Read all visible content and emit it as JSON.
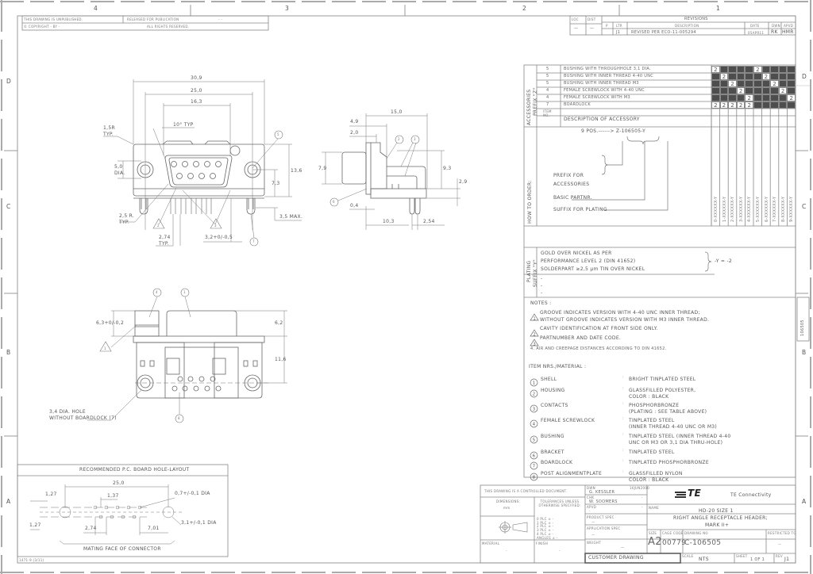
{
  "frame": {
    "col_markers": [
      "4",
      "3",
      "2",
      "1"
    ],
    "row_markers": [
      "D",
      "C",
      "B",
      "A"
    ]
  },
  "top_left_box": {
    "unpublished": "THIS DRAWING IS UNPUBLISHED.",
    "copyright": "COPYRIGHT  -   BY -",
    "released": "RELEASED FOR PUBLICATION",
    "released_value": "- -",
    "rights": "ALL RIGHTS RESERVED."
  },
  "revisions": {
    "title": "REVISIONS",
    "loc_label": "LOC",
    "dist_label": "DIST",
    "loc_value": "—",
    "dist_value": "—",
    "headers": [
      "P",
      "LTR",
      "DESCRIPTION",
      "DATE",
      "DWN",
      "APVD"
    ],
    "rows": [
      {
        "p": "",
        "ltr": "J1",
        "description": "REVISED PER ECO-11-005294",
        "date": "05APR11",
        "dwn": "RK",
        "apvd": "HMR"
      }
    ]
  },
  "accessories": {
    "side_label": "ACCESSORIES",
    "prefix_label": "PREFIX \"Z\"",
    "rows": [
      {
        "item": "5",
        "description": "BUSHING WITH THROUGHHOLE 3,1 DIA.",
        "marks": [
          "2",
          "",
          "",
          "",
          "",
          "2",
          "",
          "",
          "",
          ""
        ]
      },
      {
        "item": "5",
        "description": "BUSHING WITH INNER THREAD 4-40 UNC",
        "marks": [
          "",
          "2",
          "",
          "",
          "",
          "",
          "2",
          "",
          "",
          ""
        ]
      },
      {
        "item": "5",
        "description": "BUSHING WITH INNER THREAD M3",
        "marks": [
          "",
          "",
          "2",
          "",
          "",
          "",
          "",
          "2",
          "",
          ""
        ]
      },
      {
        "item": "4",
        "description": "FEMALE SCREWLOCK WITH 4-40 UNC",
        "marks": [
          "",
          "",
          "",
          "2",
          "",
          "",
          "",
          "",
          "2",
          ""
        ]
      },
      {
        "item": "4",
        "description": "FEMALE SCREWLOCK WITH M3",
        "marks": [
          "",
          "",
          "",
          "",
          "2",
          "",
          "",
          "",
          "",
          "2"
        ]
      },
      {
        "item": "7",
        "description": "BOARDLOCK",
        "marks": [
          "2",
          "2",
          "2",
          "2",
          "2",
          "",
          "",
          "",
          "",
          ""
        ]
      }
    ],
    "header_item": "ITEM NO.",
    "header_description": "DESCRIPTION OF ACCESSORY",
    "column_codes": [
      "0-XXXXXX-Y",
      "1-XXXXXX-Y",
      "2-XXXXXX-Y",
      "3-XXXXXX-Y",
      "4-XXXXXX-Y",
      "5-XXXXXX-Y",
      "6-XXXXXX-Y",
      "7-XXXXXX-Y",
      "8-XXXXXX-Y",
      "9-XXXXXX-Y"
    ]
  },
  "how_to_order": {
    "side_label": "HOW TO ORDER:",
    "pattern": "9 POS.------> Z-106505-Y",
    "prefix_line1": "PREFIX FOR",
    "prefix_line2": "ACCESSORIES",
    "basic": "BASIC PARTNR.",
    "suffix": "SUFFIX FOR PLATING"
  },
  "plating": {
    "side_label": "PLATING",
    "suffix_label": "SUFFIX \"Y\"",
    "lines": [
      "GOLD OVER NICKEL AS PER",
      "PERFORMANCE LEVEL 2 (DIN 41652)",
      "SOLDERPART ≥2,5    µm TIN OVER NICKEL"
    ],
    "result": "-Y = -2",
    "blanks": [
      "-",
      "-",
      "-"
    ]
  },
  "notes": {
    "title": "NOTES :",
    "items": [
      {
        "num": "1",
        "line1": "GROOVE INDICATES VERSION WITH 4-40 UNC INNER THREAD;",
        "line2": "WITHOUT GROOVE INDICATES VERSION WITH M3 INNER THREAD."
      },
      {
        "num": "2",
        "line1": "CAVITY IDENTIFICATION AT FRONT SIDE ONLY.",
        "line2": ""
      },
      {
        "num": "3",
        "line1": "PARTNUMBER AND DATE CODE.",
        "line2": ""
      }
    ],
    "note4": "4. AIR AND CREEPAGE DISTANCES ACCORDING TO DIN 41652."
  },
  "materials": {
    "title": "ITEM NRS./MATERIAL :",
    "items": [
      {
        "num": "1",
        "name": "SHELL",
        "line1": "BRIGHT TINPLATED STEEL",
        "line2": ""
      },
      {
        "num": "2",
        "name": "HOUSING",
        "line1": "GLASSFILLED POLYESTER,",
        "line2": "COLOR : BLACK"
      },
      {
        "num": "3",
        "name": "CONTACTS",
        "line1": "PHOSPHORBRONZE",
        "line2": "(PLATING : SEE TABLE ABOVE)"
      },
      {
        "num": "4",
        "name": "FEMALE SCREWLOCK",
        "line1": "TINPLATED STEEL",
        "line2": "(INNER THREAD 4-40 UNC OR M3)"
      },
      {
        "num": "5",
        "name": "BUSHING",
        "line1": "TINPLATED STEEL (INNER THREAD 4-40",
        "line2": "UNC OR M3 OR 3,1 DIA THRU-HOLE)"
      },
      {
        "num": "6",
        "name": "BRACKET",
        "line1": "TINPLATED STEEL",
        "line2": ""
      },
      {
        "num": "7",
        "name": "BOARDLOCK",
        "line1": "TINPLATED PHOSPHORBRONZE",
        "line2": ""
      },
      {
        "num": "8",
        "name": "POST ALIGNMENTPLATE",
        "line1": "GLASSFILLED NYLON",
        "line2": "COLOR : BLACK"
      }
    ]
  },
  "side_tab": "106505",
  "front_view": {
    "dims": {
      "d309": "30,9",
      "d250": "25,0",
      "d163": "16,3",
      "angle": "10° TYP",
      "r15": "1,5R",
      "r15b": "TYP.",
      "d50": "5,0",
      "d50b": "DIA.",
      "d136": "13,6",
      "d73": "7,3",
      "d35": "3,5 MAX.",
      "r25": "2,5 R.",
      "r25b": "TYP.",
      "d274": "2,74",
      "d274b": "TYP.",
      "d32": "3,2+0/-0,5"
    },
    "callouts": {
      "c5": "5",
      "c7": "7",
      "n2": "2",
      "n3": "3"
    }
  },
  "side_view": {
    "dims": {
      "d150": "15,0",
      "d49": "4,9",
      "d20": "2,0",
      "d79": "7,9",
      "d93": "9,3",
      "d29": "2,9",
      "d04": "0,4",
      "d103": "10,3",
      "d254": "2,54"
    },
    "callouts": {
      "c2": "2",
      "c3": "3",
      "c6": "6"
    }
  },
  "bottom_view": {
    "dims": {
      "d63": "6,3+0/-0,2",
      "d62": "6,2",
      "d116": "11,6",
      "hole1": "3,4 DIA. HOLE",
      "hole2": "WITHOUT BOARDLOCK (7)"
    },
    "callouts": {
      "c4": "4",
      "c1": "1",
      "c8": "8",
      "n1": "1"
    }
  },
  "pcb_layout": {
    "title": "RECOMMENDED P.C. BOARD HOLE-LAYOUT",
    "dims": {
      "d250": "25,0",
      "d127a": "1,27",
      "d137": "1,37",
      "d07": "0,7+/-0,1 DIA",
      "d127b": "1,27",
      "d274": "2,74",
      "d701": "7,01",
      "d31": "3,1+/-0,1 DIA"
    },
    "caption": "MATING FACE OF CONNECTOR"
  },
  "form_code": "1471-9 (3/11)",
  "title_block": {
    "controlled": "THIS DRAWING IS A CONTROLLED DOCUMENT.",
    "dimensions_label": "DIMENSIONS:",
    "dimensions_value": "mm",
    "tolerances_label": "TOLERANCES UNLESS OTHERWISE SPECIFIED:",
    "tolerances": [
      "0 PLC  ± -",
      "1 PLC  ± -",
      "2 PLC  ± -",
      "3 PLC  ± -",
      "4 PLC  ± -",
      "ANGLES  ± -"
    ],
    "material_label": "MATERIAL",
    "material_value": "-",
    "finish_label": "FINISH",
    "finish_value": "-",
    "dwn_label": "DWN",
    "dwn_value": "G. KESSLER",
    "date_label": "16JUN2000",
    "chk_label": "CHK",
    "chk_value": "W. SOOMERS",
    "chk_date": "-",
    "apvd_label": "APVD",
    "apvd_value": "-",
    "apvd_date": "-",
    "product_spec_label": "PRODUCT SPEC",
    "product_spec_value": "—",
    "application_spec_label": "APPLICATION SPEC",
    "application_spec_value": "—",
    "weight_label": "WEIGHT",
    "weight_value": "—",
    "customer_drawing": "CUSTOMER DRAWING",
    "logo": "TE",
    "company": "TE Connectivity",
    "name_label": "NAME",
    "name_lines": [
      "HD-20 SIZE 1",
      "RIGHT ANGLE RECEPTACLE HEADER;",
      "MARK II+"
    ],
    "size_label": "SIZE",
    "size_value": "A2",
    "cage_label": "CAGE CODE",
    "cage_value": "00779",
    "drawing_no_label": "DRAWING NO",
    "drawing_no_value": "C-106505",
    "restricted_label": "RESTRICTED TO",
    "restricted_value": "—",
    "scale_label": "SCALE",
    "scale_value": "NTS",
    "sheet_label": "SHEET",
    "sheet_value": "1 OF 1",
    "rev_label": "REV",
    "rev_value": "J1"
  }
}
